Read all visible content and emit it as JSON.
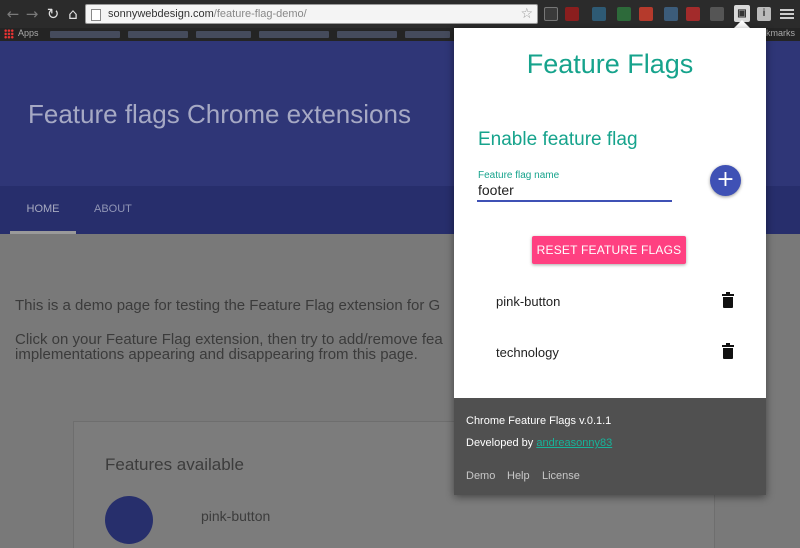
{
  "browser": {
    "url_host": "sonnywebdesign.com",
    "url_path": "/feature-flag-demo/",
    "back_icon": "back-arrow-icon",
    "forward_icon": "forward-arrow-icon",
    "reload_icon": "reload-icon",
    "home_icon": "home-icon",
    "star_icon": "star-icon"
  },
  "bookmarks": {
    "apps_label": "Apps",
    "right_label": "kmarks"
  },
  "page": {
    "hero_title": "Feature flags Chrome extensions",
    "nav": {
      "home": "HOME",
      "about": "ABOUT"
    },
    "intro_line1": "This is a demo page for testing the Feature Flag extension for G",
    "intro_line2": "Click on your Feature Flag extension, then try to add/remove fea",
    "intro_line3": "implementations appearing and disappearing from this page.",
    "card_title": "Features available",
    "card_item": "pink-button"
  },
  "popup": {
    "title": "Feature Flags",
    "section_title": "Enable feature flag",
    "field_label": "Feature flag name",
    "field_value": "footer",
    "add_label": "+",
    "reset_label": "RESET FEATURE FLAGS",
    "flags": [
      {
        "name": "pink-button"
      },
      {
        "name": "technology"
      }
    ],
    "footer": {
      "version": "Chrome Feature Flags v.0.1.1",
      "developed_by": "Developed by",
      "author": "andreasonny83",
      "links": {
        "demo": "Demo",
        "help": "Help",
        "license": "License"
      }
    }
  },
  "colors": {
    "accent_teal": "#16a38c",
    "primary_indigo": "#3f51b5",
    "reset_pink": "#ff4081",
    "footer_gray": "#505050"
  }
}
